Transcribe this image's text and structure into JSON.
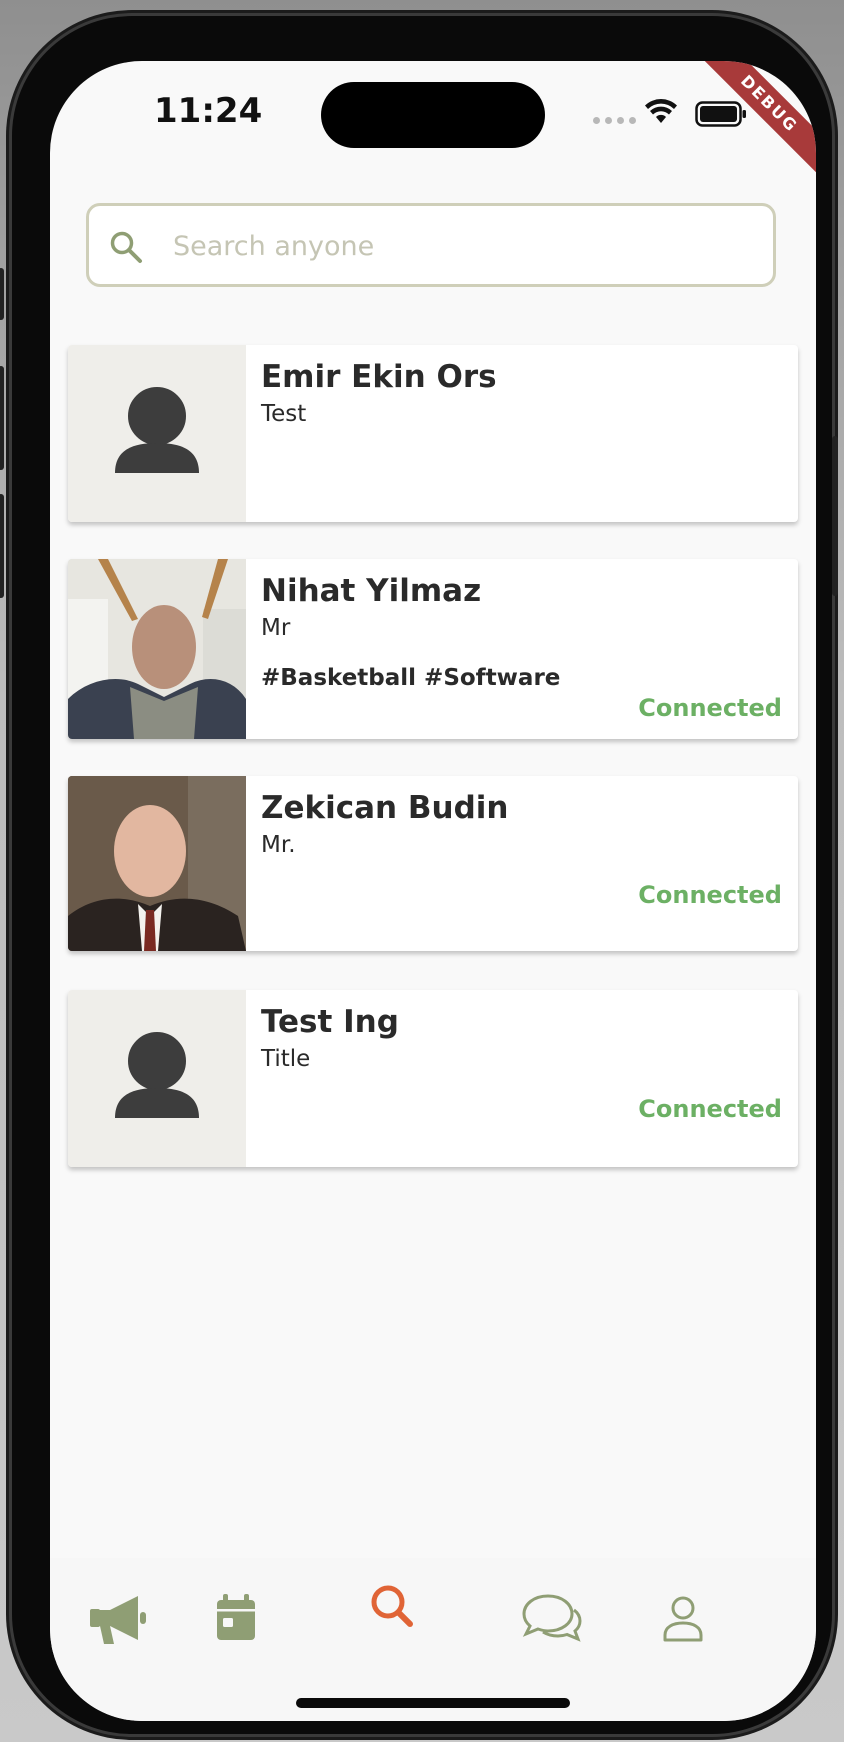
{
  "status_bar": {
    "time": "11:24"
  },
  "debug_banner": "DEBUG",
  "search": {
    "placeholder": "Search anyone",
    "value": ""
  },
  "results": [
    {
      "name": "Emir Ekin Ors",
      "title": "Test",
      "tags": "",
      "status": "",
      "avatar": "default-avatar"
    },
    {
      "name": "Nihat Yilmaz",
      "title": "Mr",
      "tags": "#Basketball #Software",
      "status": "Connected",
      "avatar": "photo"
    },
    {
      "name": "Zekican Budin",
      "title": "Mr.",
      "tags": "",
      "status": "Connected",
      "avatar": "photo"
    },
    {
      "name": "Test Ing",
      "title": "Title",
      "tags": "",
      "status": "Connected",
      "avatar": "default-avatar"
    }
  ],
  "nav": {
    "items": [
      {
        "icon": "megaphone-icon",
        "active": false
      },
      {
        "icon": "calendar-icon",
        "active": false
      },
      {
        "icon": "search-icon",
        "active": true
      },
      {
        "icon": "chat-bubbles-icon",
        "active": false
      },
      {
        "icon": "profile-icon",
        "active": false
      }
    ]
  },
  "colors": {
    "accent_active": "#e06436",
    "nav_inactive": "#8f9e74",
    "connected": "#6cb064",
    "debug_banner": "#a83a3a"
  }
}
